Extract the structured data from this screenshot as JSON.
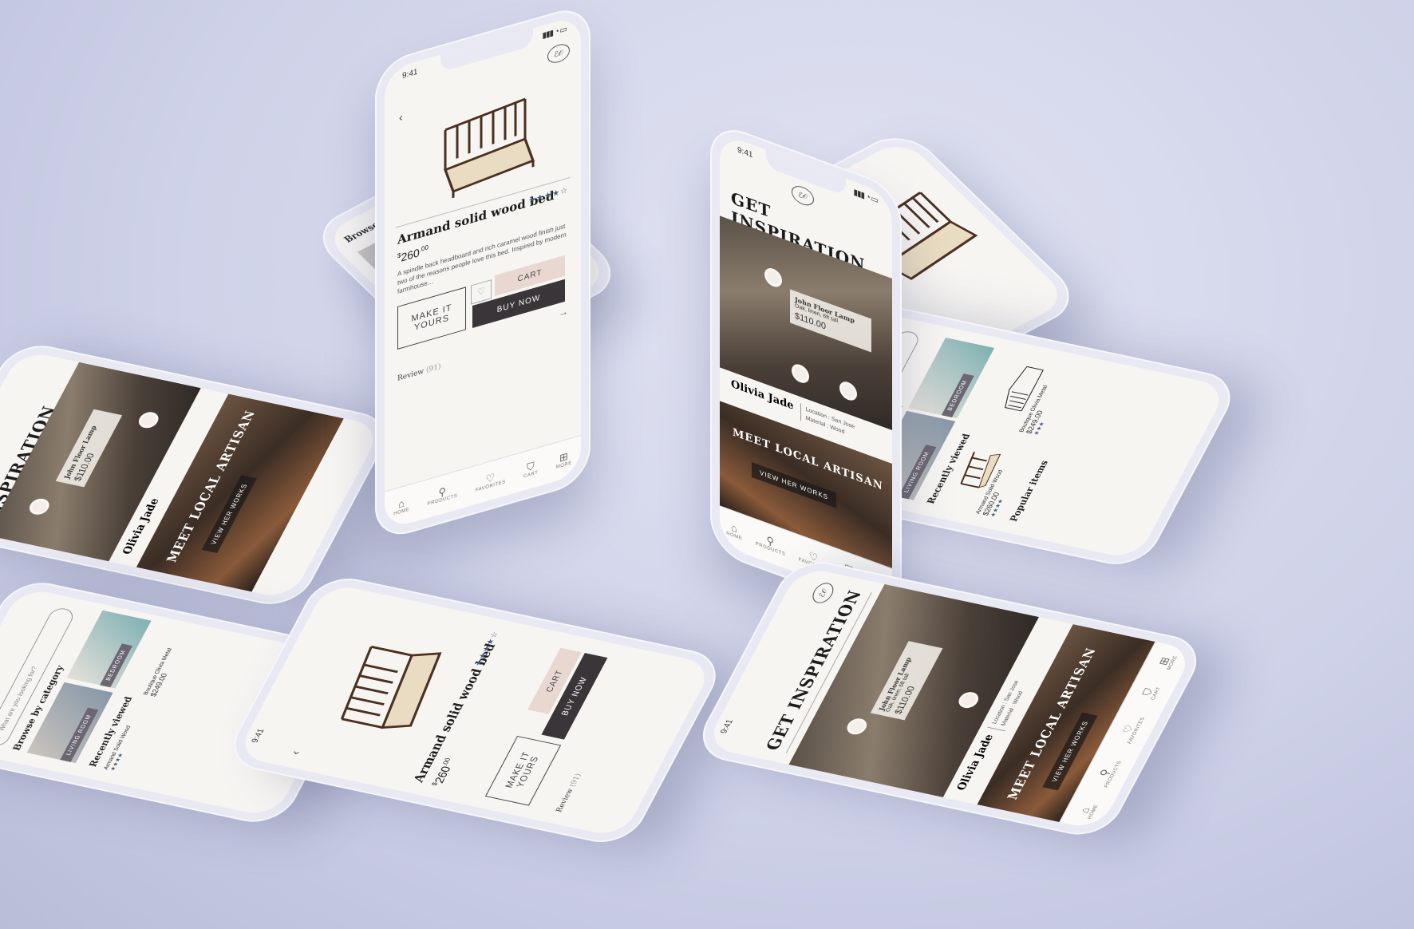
{
  "status_time": "9:41",
  "logo_text": "ℰ𝒪",
  "nav": [
    {
      "icon": "home-icon",
      "glyph": "⌂",
      "label": "HOME"
    },
    {
      "icon": "search-icon",
      "glyph": "⚲",
      "label": "PRODUCTS"
    },
    {
      "icon": "heart-icon",
      "glyph": "♡",
      "label": "FAVORITES"
    },
    {
      "icon": "cart-icon",
      "glyph": "⛉",
      "label": "CART"
    },
    {
      "icon": "more-icon",
      "glyph": "⊞",
      "label": "MORE"
    }
  ],
  "inspiration": {
    "title": "GET INSPIRATION",
    "lamp_name": "John Floor Lamp",
    "lamp_sub": "Oak, linen, 6ft tall",
    "lamp_price": "$110.00",
    "artisan_name": "Olivia Jade",
    "artisan_location": "Location : San Jose",
    "artisan_material": "Material : Wood",
    "banner_title": "MEET LOCAL ARTISAN",
    "banner_button": "VIEW HER WORKS"
  },
  "product": {
    "back": "‹",
    "name": "Armand solid wood bed",
    "rating_stars": "★★★★☆",
    "price_symbol": "$",
    "price_main": "260",
    "price_cents": ".00",
    "description": "A spindle back headboard and rich caramel wood finish just two of the reasons people love this bed. Inspired by modern farmhouse…",
    "make_it_yours": "MAKE IT YOURS",
    "cart": "CART",
    "buy_now": "BUY NOW",
    "arrow": "→",
    "review_label": "Review",
    "review_count": "(91)"
  },
  "browse": {
    "search_placeholder": "What are you looking for?",
    "by_category": "Browse by category",
    "cat_1": "LIVING ROOM",
    "cat_2": "BEDROOM",
    "recently_viewed": "Recently viewed",
    "rv_1_name": "Armand Solid Wood",
    "rv_1_price": "$260.00",
    "rv_1_stars": "★★★★",
    "rv_2_name": "Boutique Olivia Metal",
    "rv_2_price": "$249.00",
    "rv_2_stars": "★★★",
    "popular": "Popular items"
  }
}
